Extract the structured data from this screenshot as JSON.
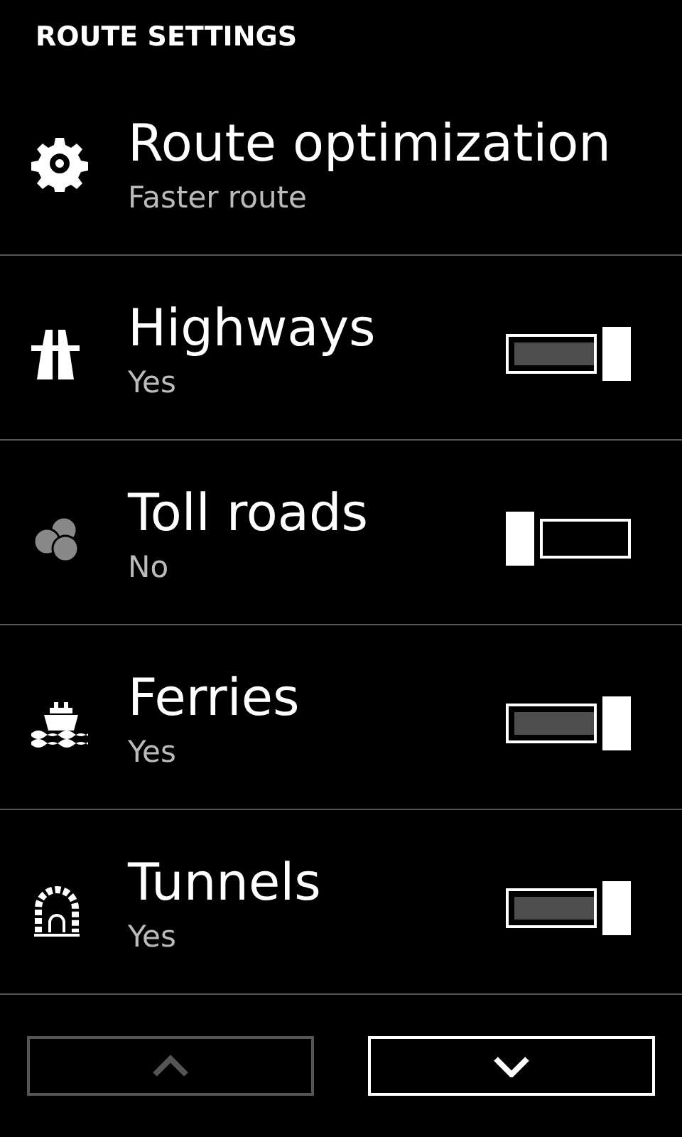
{
  "header": {
    "title": "ROUTE SETTINGS"
  },
  "items": [
    {
      "kind": "option",
      "title": "Route optimization",
      "value": "Faster route"
    },
    {
      "kind": "toggle",
      "title": "Highways",
      "value": "Yes",
      "on": true
    },
    {
      "kind": "toggle",
      "title": "Toll roads",
      "value": "No",
      "on": false
    },
    {
      "kind": "toggle",
      "title": "Ferries",
      "value": "Yes",
      "on": true
    },
    {
      "kind": "toggle",
      "title": "Tunnels",
      "value": "Yes",
      "on": true
    }
  ],
  "pager": {
    "up": {
      "disabled": true
    },
    "down": {
      "disabled": false
    }
  }
}
